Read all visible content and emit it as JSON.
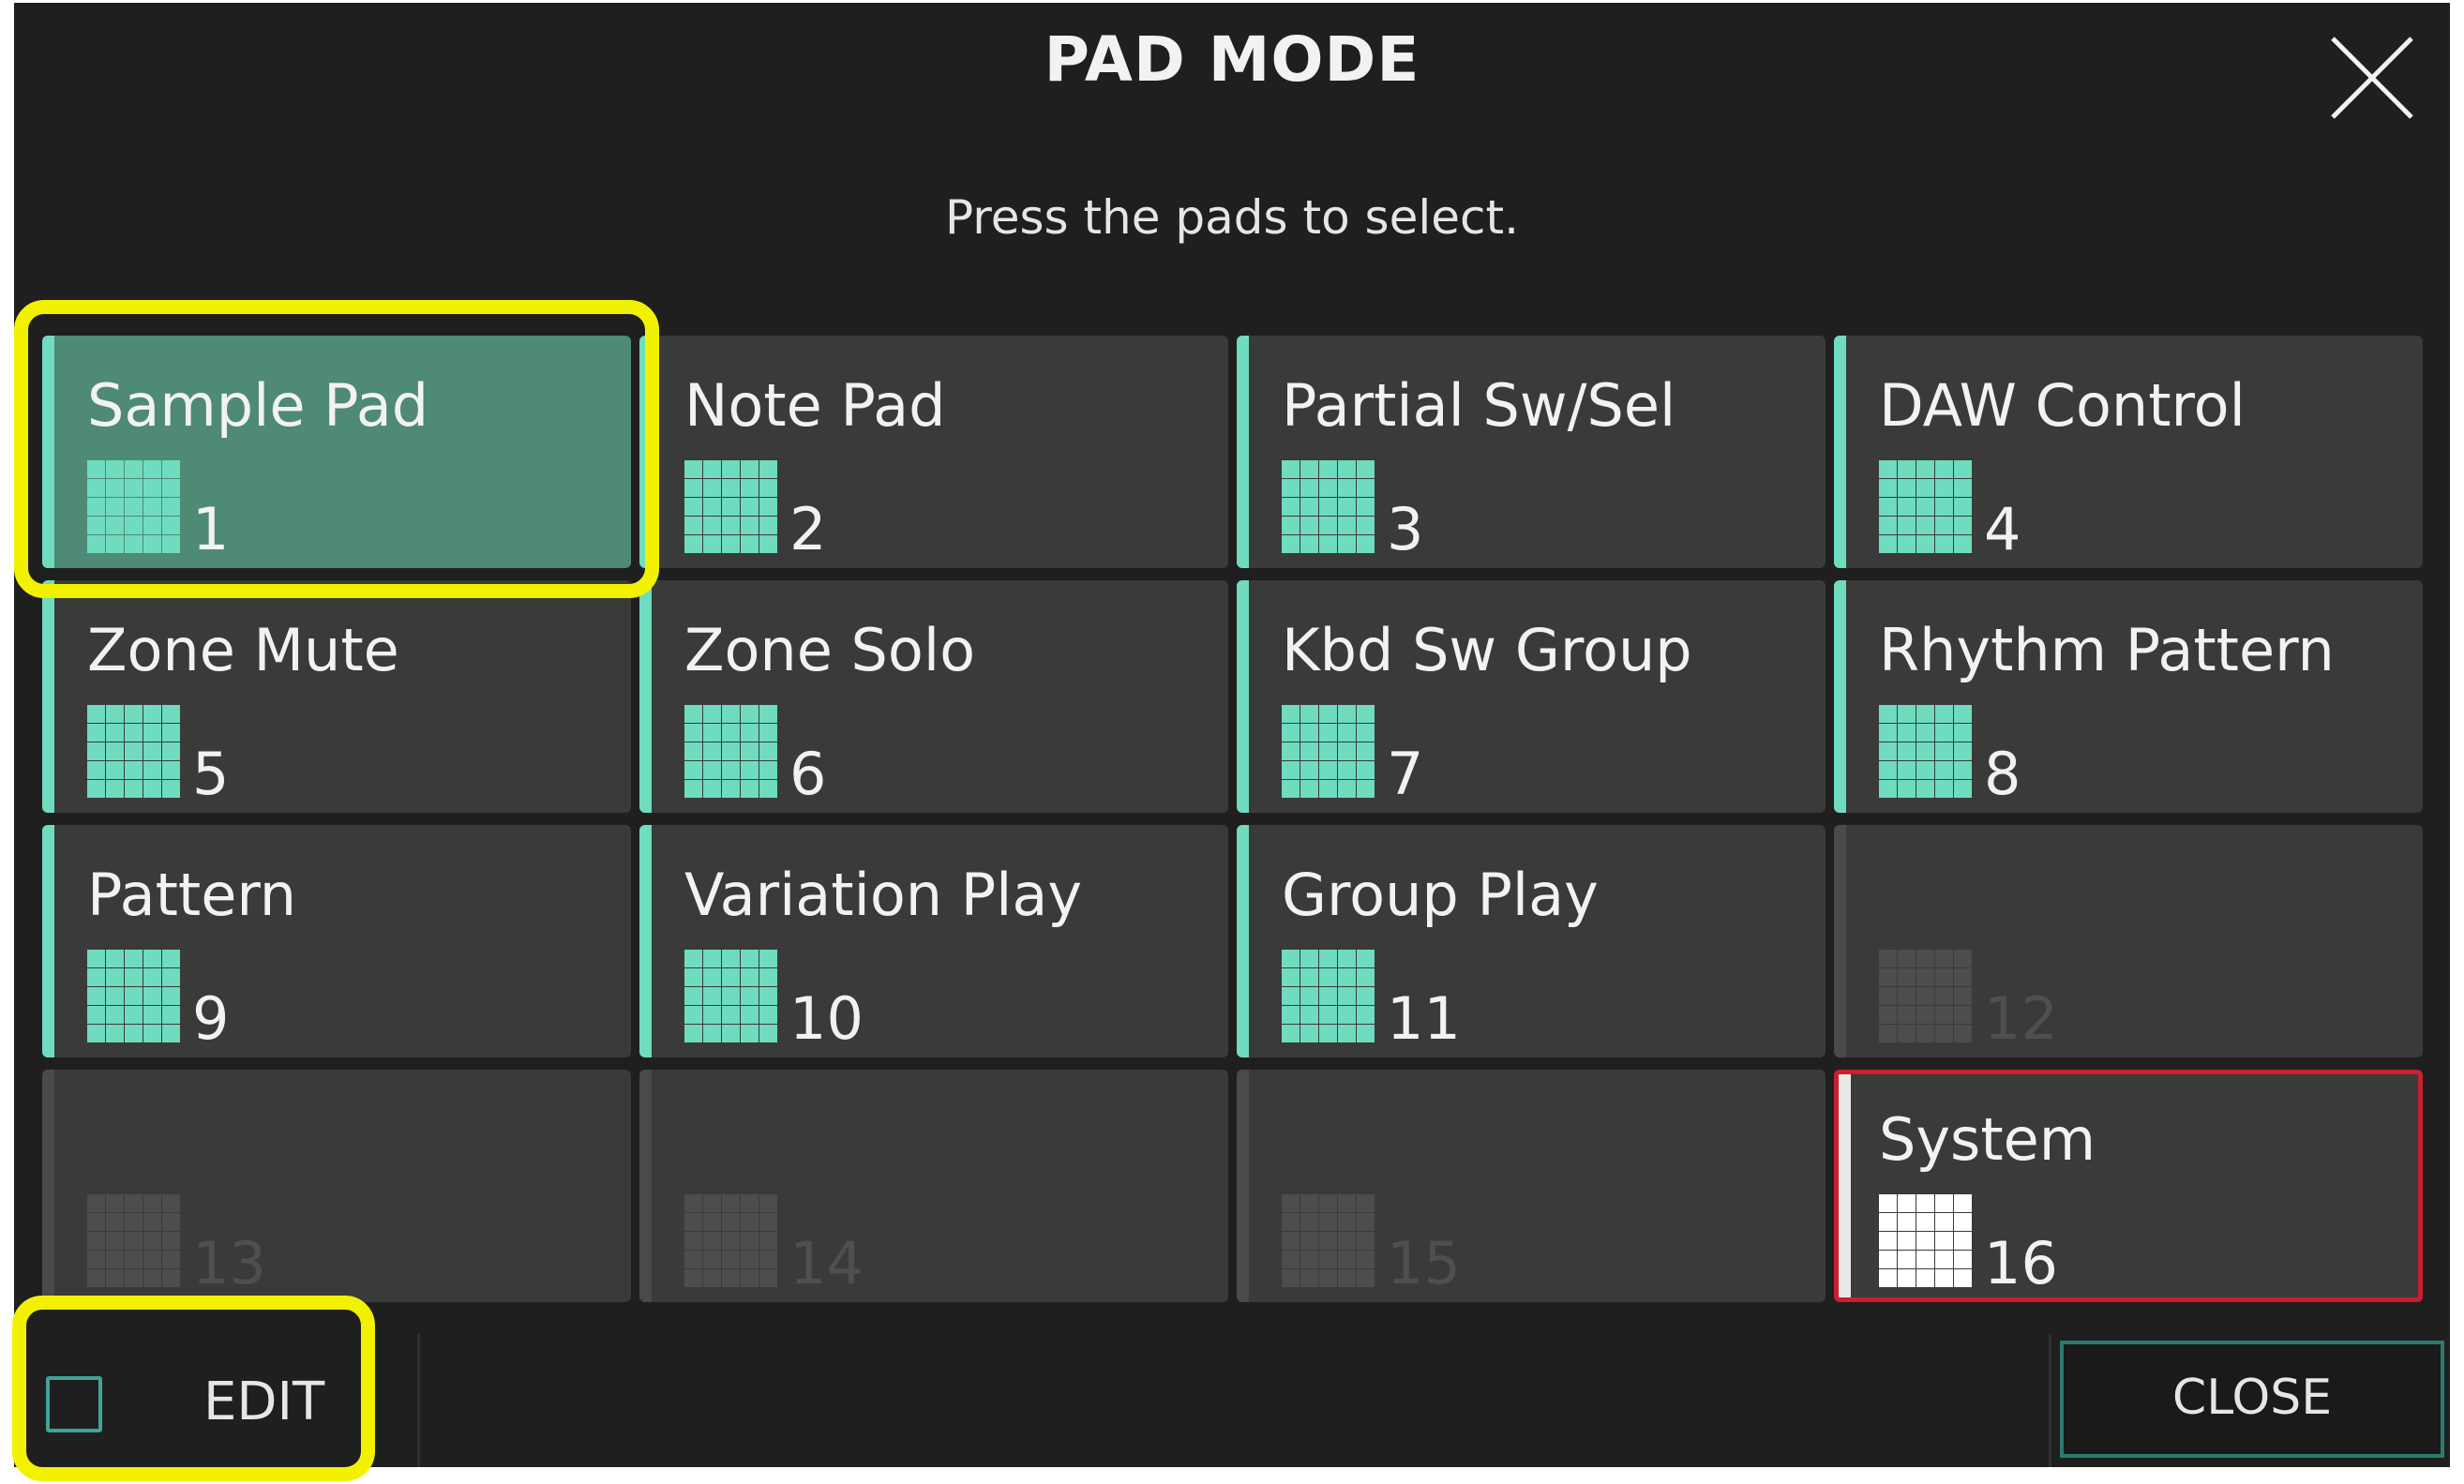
{
  "header": {
    "title": "PAD MODE",
    "subtitle": "Press the pads to select."
  },
  "pads": [
    {
      "label": "Sample Pad",
      "number": "1"
    },
    {
      "label": "Note Pad",
      "number": "2"
    },
    {
      "label": "Partial Sw/Sel",
      "number": "3"
    },
    {
      "label": "DAW Control",
      "number": "4"
    },
    {
      "label": "Zone Mute",
      "number": "5"
    },
    {
      "label": "Zone Solo",
      "number": "6"
    },
    {
      "label": "Kbd Sw Group",
      "number": "7"
    },
    {
      "label": "Rhythm Pattern",
      "number": "8"
    },
    {
      "label": "Pattern",
      "number": "9"
    },
    {
      "label": "Variation Play",
      "number": "10"
    },
    {
      "label": "Group Play",
      "number": "11"
    },
    {
      "label": "",
      "number": "12"
    },
    {
      "label": "",
      "number": "13"
    },
    {
      "label": "",
      "number": "14"
    },
    {
      "label": "",
      "number": "15"
    },
    {
      "label": "System",
      "number": "16"
    }
  ],
  "footer": {
    "edit_label": "EDIT",
    "close_label": "CLOSE"
  },
  "colors": {
    "accent": "#6fdcbf",
    "selected_pad": "#4e8a76",
    "system_border": "#c8202c",
    "highlight": "#f2f200"
  }
}
